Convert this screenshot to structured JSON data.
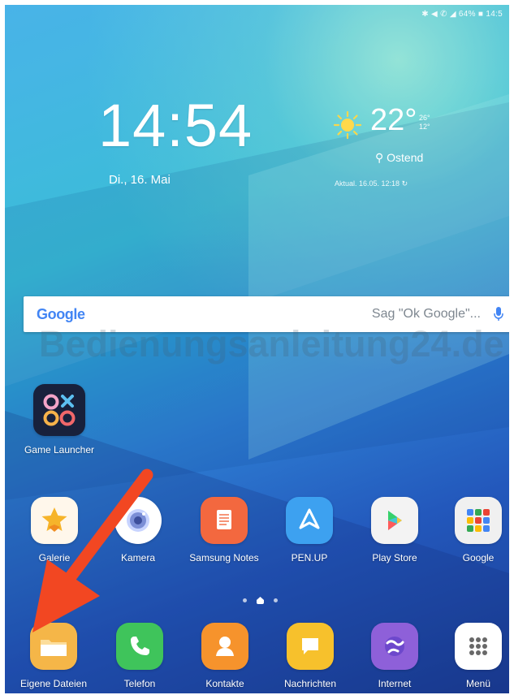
{
  "status_bar": {
    "text": "✱ ◀ ✆ ◢ 64% ■ 14:5"
  },
  "clock": {
    "time": "14:54",
    "date": "Di., 16. Mai"
  },
  "weather": {
    "temperature": "22°",
    "high": "26°",
    "low": "12°",
    "location": "Ostend",
    "updated": "Aktual. 16.05. 12:18"
  },
  "search": {
    "logo": "Google",
    "placeholder": "Sag \"Ok Google\"..."
  },
  "watermark": "Bedienungsanleitung24.de",
  "home_apps": {
    "game_launcher": "Game Launcher",
    "row1": [
      "Galerie",
      "Kamera",
      "Samsung Notes",
      "PEN.UP",
      "Play Store",
      "Google"
    ],
    "dock": [
      "Eigene Dateien",
      "Telefon",
      "Kontakte",
      "Nachrichten",
      "Internet",
      "Menü"
    ]
  },
  "colors": {
    "wall_top": "#3caee7",
    "wall_bottom": "#1a3c93",
    "arrow": "#f24722"
  }
}
